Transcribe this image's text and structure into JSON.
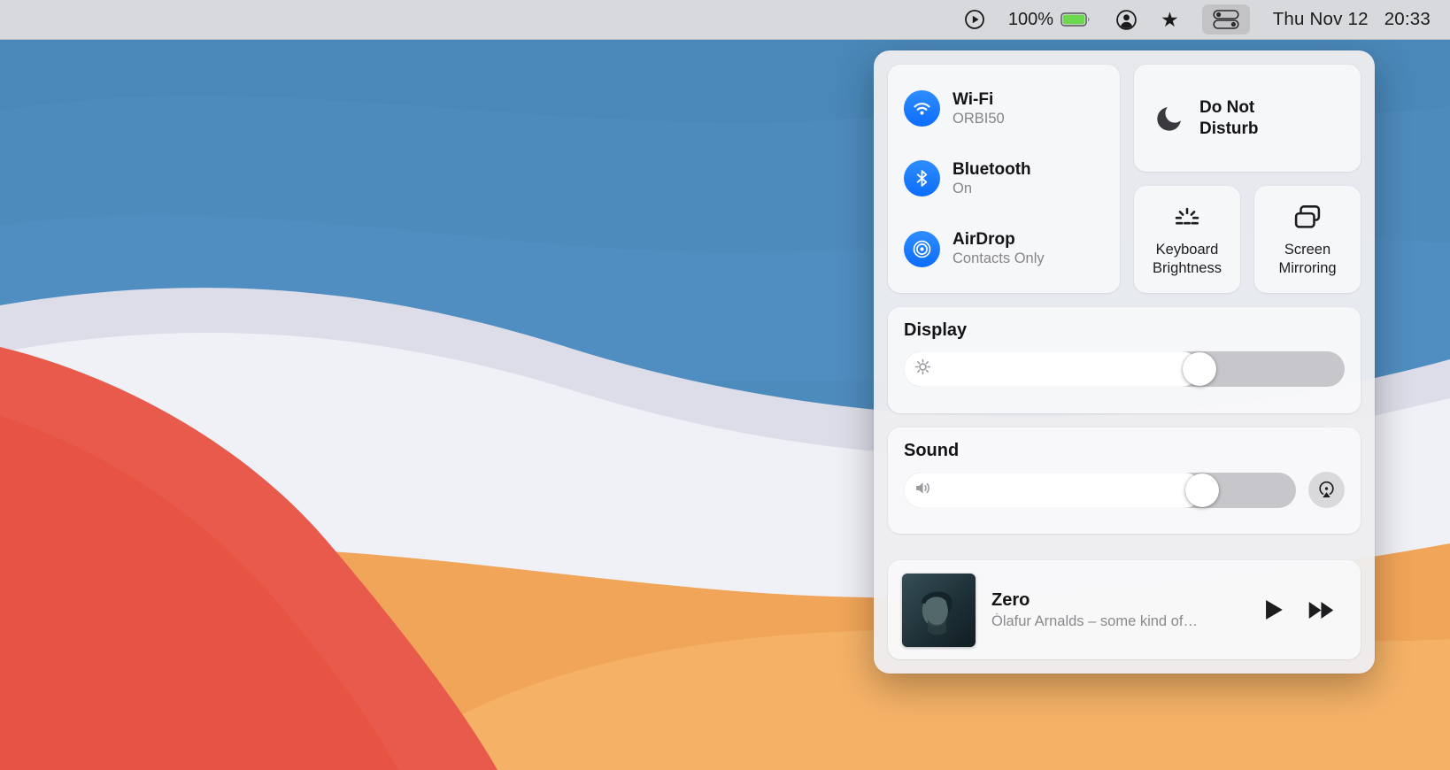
{
  "menu_bar": {
    "battery": {
      "percent": "100%"
    },
    "clock": {
      "date": "Thu Nov 12",
      "time": "20:33"
    },
    "star_glyph": "★"
  },
  "control_center": {
    "wifi": {
      "label": "Wi-Fi",
      "status": "ORBI50"
    },
    "bluetooth": {
      "label": "Bluetooth",
      "status": "On"
    },
    "airdrop": {
      "label": "AirDrop",
      "status": "Contacts Only"
    },
    "do_not_disturb": {
      "label": "Do Not Disturb"
    },
    "keyboard_brightness": {
      "label": "Keyboard Brightness"
    },
    "screen_mirroring": {
      "label": "Screen Mirroring"
    },
    "display": {
      "title": "Display",
      "brightness_percent": 67
    },
    "sound": {
      "title": "Sound",
      "volume_percent": 76
    },
    "now_playing": {
      "title": "Zero",
      "subtitle": "Ólafur Arnalds – some kind of…"
    }
  },
  "colors": {
    "accent_blue": "#0a7aff",
    "battery_green": "#6bd84e",
    "panel_bg": "#ededef",
    "wallpaper_blue": "#4e8bbd",
    "wallpaper_red": "#e85a4b",
    "wallpaper_orange": "#f1a559"
  }
}
